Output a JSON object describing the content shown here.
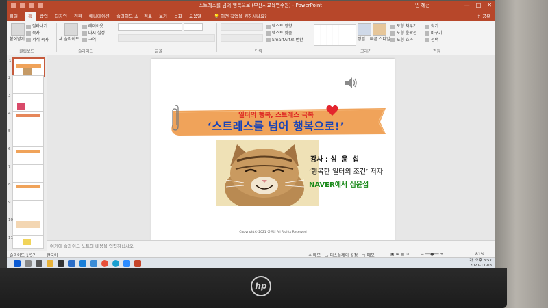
{
  "app": {
    "document_title": "스트레스를 넘어 행복으로 (부산시교육연수원) - PowerPoint",
    "user_name": "민 혜전",
    "window_controls": [
      "—",
      "□",
      "✕"
    ]
  },
  "ribbon_tabs": [
    "파일",
    "홈",
    "삽입",
    "디자인",
    "전환",
    "애니메이션",
    "슬라이드 쇼",
    "검토",
    "보기",
    "녹화",
    "도움말"
  ],
  "tell_me": "어떤 작업을 원하시나요?",
  "share_label": "공유",
  "ribbon": {
    "clipboard": {
      "paste": "붙여넣기",
      "cut": "잘라내기",
      "copy": "복사",
      "format_painter": "서식 복사",
      "group": "클립보드"
    },
    "slides": {
      "new_slide": "새 슬라이드",
      "layout": "레이아웃",
      "reset": "다시 설정",
      "section": "구역",
      "group": "슬라이드"
    },
    "font_group": "글꼴",
    "paragraph": {
      "text_direction": "텍스트 방향",
      "align_text": "텍스트 맞춤",
      "smartart": "SmartArt로 변환",
      "group": "단락"
    },
    "drawing": {
      "arrange": "정렬",
      "quick_styles": "빠른 스타일",
      "shape_fill": "도형 채우기",
      "shape_outline": "도형 윤곽선",
      "shape_effects": "도형 효과",
      "group": "그리기"
    },
    "editing": {
      "find": "찾기",
      "replace": "바꾸기",
      "select": "선택",
      "group": "편집"
    }
  },
  "thumbnails": [
    {
      "num": "1"
    },
    {
      "num": "2"
    },
    {
      "num": "3"
    },
    {
      "num": "4"
    },
    {
      "num": "5"
    },
    {
      "num": "6"
    },
    {
      "num": "7"
    },
    {
      "num": "8"
    },
    {
      "num": "9"
    },
    {
      "num": "10"
    },
    {
      "num": "11"
    }
  ],
  "slide": {
    "subtitle": "일터의 행복, 스트레스 극복",
    "title": "‘스트레스를 넘어 행복으로!’",
    "lecturer": "강사 : 심  윤  섭",
    "book": "‘행복한 일터의 조건’ 저자",
    "naver": "NAVER에서 심윤섭",
    "copyright": "Copyright© 2021 심윤섭 All Rights Reserved"
  },
  "notes_placeholder": "여기에 슬라이드 노트의 내용을 입력하십시오",
  "status": {
    "slide_counter": "슬라이드 1/57",
    "language": "한국어",
    "notes_btn": "메모",
    "display_settings": "디스플레이 설정",
    "comments_btn": "메모",
    "zoom": "81%"
  },
  "taskbar": {
    "time": "오후 8:57",
    "date": "2021-11-03",
    "ime": "가"
  },
  "colors": {
    "accent": "#b7472a",
    "title_blue": "#1743b8",
    "subtitle_red": "#dd2222",
    "naver_green": "#1a8a1a",
    "banner_orange": "#f0a35a"
  }
}
